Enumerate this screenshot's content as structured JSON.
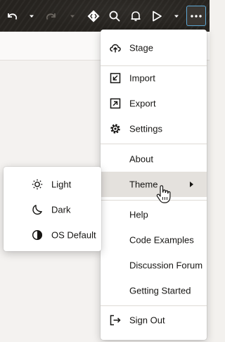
{
  "toolbar": {
    "undo_icon": "undo-icon",
    "redo_icon": "redo-icon",
    "diamond_icon": "code-diamond-icon",
    "search_icon": "search-icon",
    "bell_icon": "bell-icon",
    "run_icon": "play-icon",
    "more_icon": "more-horizontal-icon"
  },
  "menu": {
    "items": [
      {
        "label": "Stage",
        "icon": "upload-cloud-icon"
      },
      {
        "label": "Import",
        "icon": "import-icon"
      },
      {
        "label": "Export",
        "icon": "export-icon"
      },
      {
        "label": "Settings",
        "icon": "gear-icon"
      },
      {
        "label": "About",
        "icon": ""
      },
      {
        "label": "Theme",
        "icon": "",
        "has_submenu": true
      },
      {
        "label": "Help",
        "icon": ""
      },
      {
        "label": "Code Examples",
        "icon": ""
      },
      {
        "label": "Discussion Forum",
        "icon": ""
      },
      {
        "label": "Getting Started",
        "icon": ""
      },
      {
        "label": "Sign Out",
        "icon": "sign-out-icon"
      }
    ]
  },
  "theme_submenu": {
    "items": [
      {
        "label": "Light",
        "icon": "sun-icon"
      },
      {
        "label": "Dark",
        "icon": "moon-icon"
      },
      {
        "label": "OS Default",
        "icon": "half-circle-icon"
      }
    ]
  },
  "colors": {
    "toolbar_bg": "#26231f",
    "focus_ring": "#5fa9d6",
    "hover_bg": "#e4e1dd"
  }
}
